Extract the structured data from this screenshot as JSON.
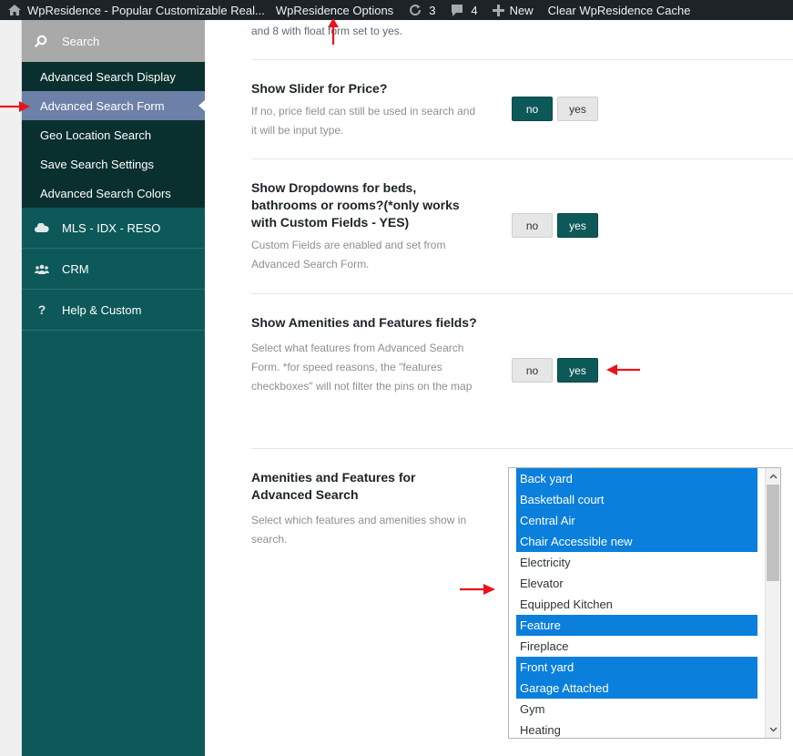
{
  "adminbar": {
    "site_name": "WpResidence - Popular Customizable Real...",
    "options": "WpResidence Options",
    "updates_count": "3",
    "comments_count": "4",
    "new_label": "New",
    "cache_label": "Clear WpResidence Cache"
  },
  "sidebar": {
    "search_label": "Search",
    "sub_items": [
      {
        "label": "Advanced Search Display"
      },
      {
        "label": "Advanced Search Form"
      },
      {
        "label": "Geo Location Search"
      },
      {
        "label": "Save Search Settings"
      },
      {
        "label": "Advanced Search Colors"
      }
    ],
    "active_sub": "Advanced Search Form",
    "main_items": [
      {
        "label": "MLS - IDX - RESO",
        "icon": "cloud-icon"
      },
      {
        "label": "CRM",
        "icon": "users-icon"
      },
      {
        "label": "Help & Custom",
        "icon": "question-icon"
      }
    ]
  },
  "content": {
    "top_note": "and 8 with float form set to yes.",
    "sections": [
      {
        "title": "Show Slider for Price?",
        "desc": "If no, price field can still be used in search and it will be input type.",
        "no": "no",
        "yes": "yes",
        "selected": "no"
      },
      {
        "title": "Show Dropdowns for beds, bathrooms or rooms?(*only works with Custom Fields - YES)",
        "desc": "Custom Fields are enabled and set from Advanced Search Form.",
        "no": "no",
        "yes": "yes",
        "selected": "yes"
      },
      {
        "title": "Show Amenities and Features fields?",
        "desc": "Select what features from Advanced Search Form. *for speed reasons, the \"features checkboxes\" will not filter the pins on the map",
        "no": "no",
        "yes": "yes",
        "selected": "yes"
      },
      {
        "title": "Amenities and Features for Advanced Search",
        "desc": "Select which features and amenities show in search."
      }
    ],
    "features_list": [
      {
        "label": "Back yard",
        "selected": true
      },
      {
        "label": "Basketball court",
        "selected": true
      },
      {
        "label": "Central Air",
        "selected": true
      },
      {
        "label": "Chair Accessible new",
        "selected": true
      },
      {
        "label": "Electricity",
        "selected": false
      },
      {
        "label": "Elevator",
        "selected": false
      },
      {
        "label": "Equipped Kitchen",
        "selected": false
      },
      {
        "label": "Feature",
        "selected": true
      },
      {
        "label": "Fireplace",
        "selected": false
      },
      {
        "label": "Front yard",
        "selected": true
      },
      {
        "label": "Garage Attached",
        "selected": true
      },
      {
        "label": "Gym",
        "selected": false
      },
      {
        "label": "Heating",
        "selected": false
      }
    ]
  },
  "colors": {
    "sidebar_bg": "#0d5858",
    "active_btn": "#0d5858",
    "selected_option": "#0b7fdc",
    "annotation_arrow": "#e8141c"
  }
}
